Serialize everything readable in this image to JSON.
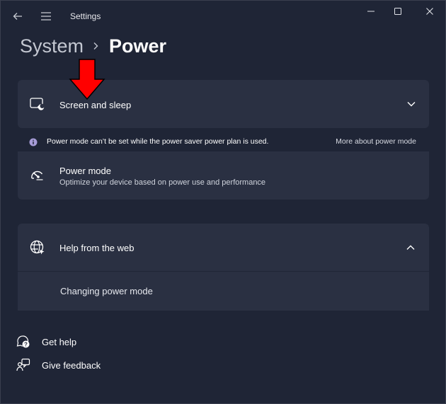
{
  "titlebar": {
    "app_title": "Settings",
    "back_icon": "back-arrow-icon",
    "menu_icon": "hamburger-menu-icon",
    "minimize_icon": "minimize-icon",
    "maximize_icon": "maximize-icon",
    "close_icon": "close-icon"
  },
  "breadcrumb": {
    "parent": "System",
    "current": "Power",
    "separator_icon": "chevron-right-icon"
  },
  "screen_sleep": {
    "label": "Screen and sleep",
    "icon": "display-sleep-icon",
    "expand_icon": "chevron-down-icon",
    "expanded": false
  },
  "notice": {
    "text": "Power mode can’t be set while the power saver power plan is used.",
    "link": "More about power mode",
    "icon": "info-icon"
  },
  "power_mode": {
    "title": "Power mode",
    "subtitle": "Optimize your device based on power use and performance",
    "icon": "gauge-icon"
  },
  "help": {
    "title": "Help from the web",
    "icon": "globe-icon",
    "collapse_icon": "chevron-up-icon",
    "expanded": true,
    "links": [
      "Changing power mode"
    ]
  },
  "footer": {
    "get_help": "Get help",
    "give_feedback": "Give feedback"
  },
  "annotation": {
    "arrow_color": "#ff0000"
  },
  "colors": {
    "background": "#1f2536",
    "card": "#2a3042",
    "info_accent": "#a79dd8"
  }
}
